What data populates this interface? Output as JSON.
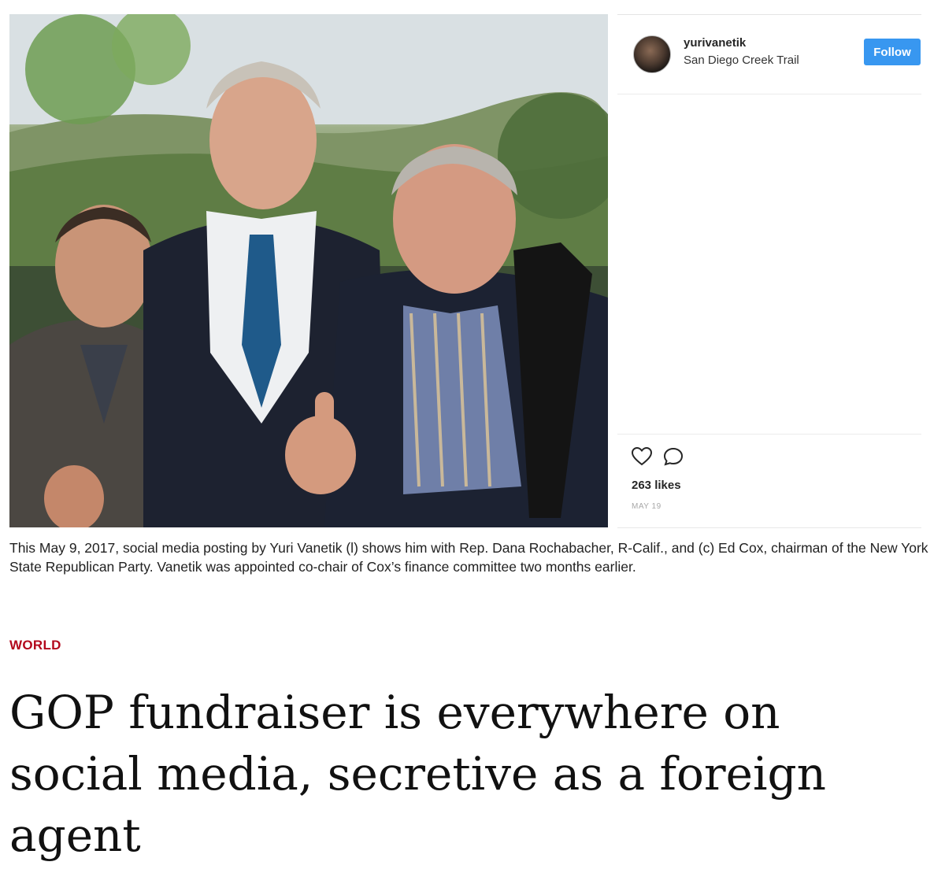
{
  "post": {
    "username": "yurivanetik",
    "location": "San Diego Creek Trail",
    "follow_label": "Follow",
    "likes": "263 likes",
    "date": "MAY 19",
    "icons": [
      "heart-icon",
      "comment-icon"
    ],
    "accent_color": "#3897f0"
  },
  "article": {
    "caption": "This May 9, 2017, social media posting by Yuri Vanetik (l) shows him with Rep. Dana Rochabacher, R-Calif., and (c) Ed Cox, chairman of the New York State Republican Party. Vanetik was appointed co-chair of Cox’s finance committee two months earlier.",
    "section": "WORLD",
    "section_color": "#b3081c",
    "headline": "GOP fundraiser is everywhere on social media, secretive as a foreign agent"
  }
}
